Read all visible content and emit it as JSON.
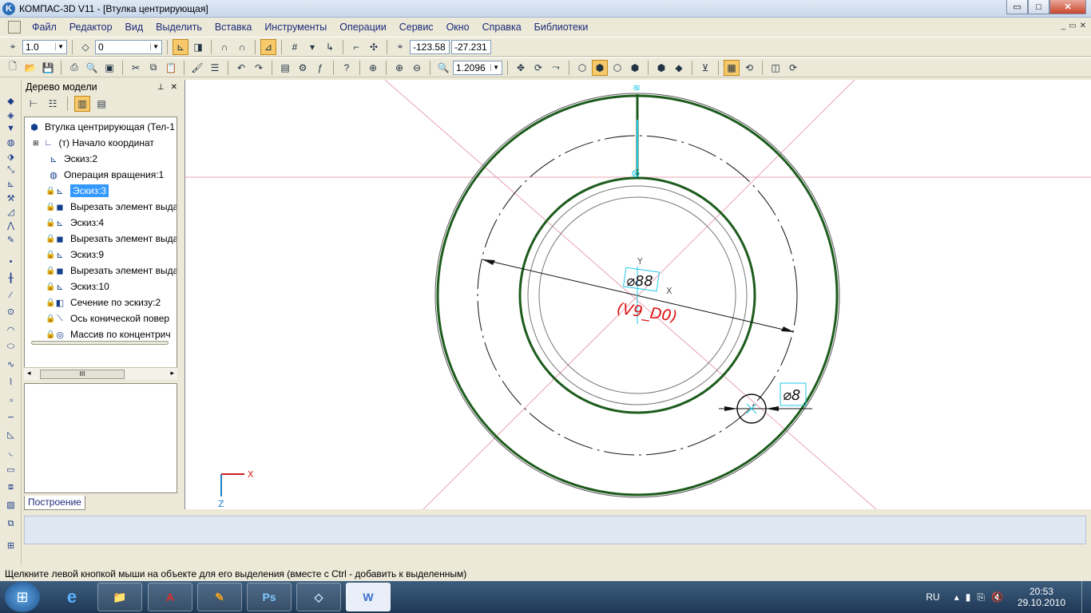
{
  "window": {
    "title": "КОМПАС-3D V11 - [Втулка центрирующая]",
    "app_icon": "K",
    "minimize": "▭",
    "maximize": "□",
    "close": "✕"
  },
  "menu": {
    "items": [
      "Файл",
      "Редактор",
      "Вид",
      "Выделить",
      "Вставка",
      "Инструменты",
      "Операции",
      "Сервис",
      "Окно",
      "Справка",
      "Библиотеки"
    ],
    "mdi_buttons": [
      "_",
      "▭",
      "✕"
    ]
  },
  "toolbar1": {
    "step": "1.0",
    "layer": "0",
    "coord_x": "-123.58",
    "coord_y": "-27.231"
  },
  "toolbar2": {
    "zoom": "1.2096"
  },
  "tree_panel": {
    "title": "Дерево модели",
    "pin_icon": "📌",
    "close_icon": "✕",
    "items": [
      {
        "label": "Втулка центрирующая (Тел-1",
        "icon": "part-icon"
      },
      {
        "label": "(т) Начало координат",
        "icon": "origin-icon"
      },
      {
        "label": "Эскиз:2",
        "icon": "sketch-icon"
      },
      {
        "label": "Операция вращения:1",
        "icon": "rotation-icon"
      },
      {
        "label": "Эскиз:3",
        "icon": "sketch-icon"
      },
      {
        "label": "Вырезать элемент выда",
        "icon": "cut-extrude-icon"
      },
      {
        "label": "Эскиз:4",
        "icon": "sketch-icon"
      },
      {
        "label": "Вырезать элемент выда",
        "icon": "cut-extrude-icon"
      },
      {
        "label": "Эскиз:9",
        "icon": "sketch-icon"
      },
      {
        "label": "Вырезать элемент выда",
        "icon": "cut-extrude-icon"
      },
      {
        "label": "Эскиз:10",
        "icon": "sketch-icon"
      },
      {
        "label": "Сечение по эскизу:2",
        "icon": "section-icon"
      },
      {
        "label": "Ось конической повер",
        "icon": "axis-icon"
      },
      {
        "label": "Массив по концентрич",
        "icon": "pattern-icon"
      }
    ],
    "scroll_thumb": "III",
    "build_tab": "Построение"
  },
  "drawing": {
    "dim_large": "⌀88",
    "dim_small": "⌀8",
    "red_label": "(V9_D0)",
    "axis_y": "Y",
    "axis_x": "X",
    "triad_x": "X",
    "triad_z": "Z"
  },
  "status_text": "Щелкните левой кнопкой мыши на объекте для его выделения (вместе с Ctrl - добавить к выделенным)",
  "taskbar": {
    "apps": [
      "e",
      "📁",
      "A",
      "✎",
      "Ps",
      "◇",
      "W"
    ],
    "lang": "RU",
    "time": "20:53",
    "date": "29.10.2010"
  }
}
